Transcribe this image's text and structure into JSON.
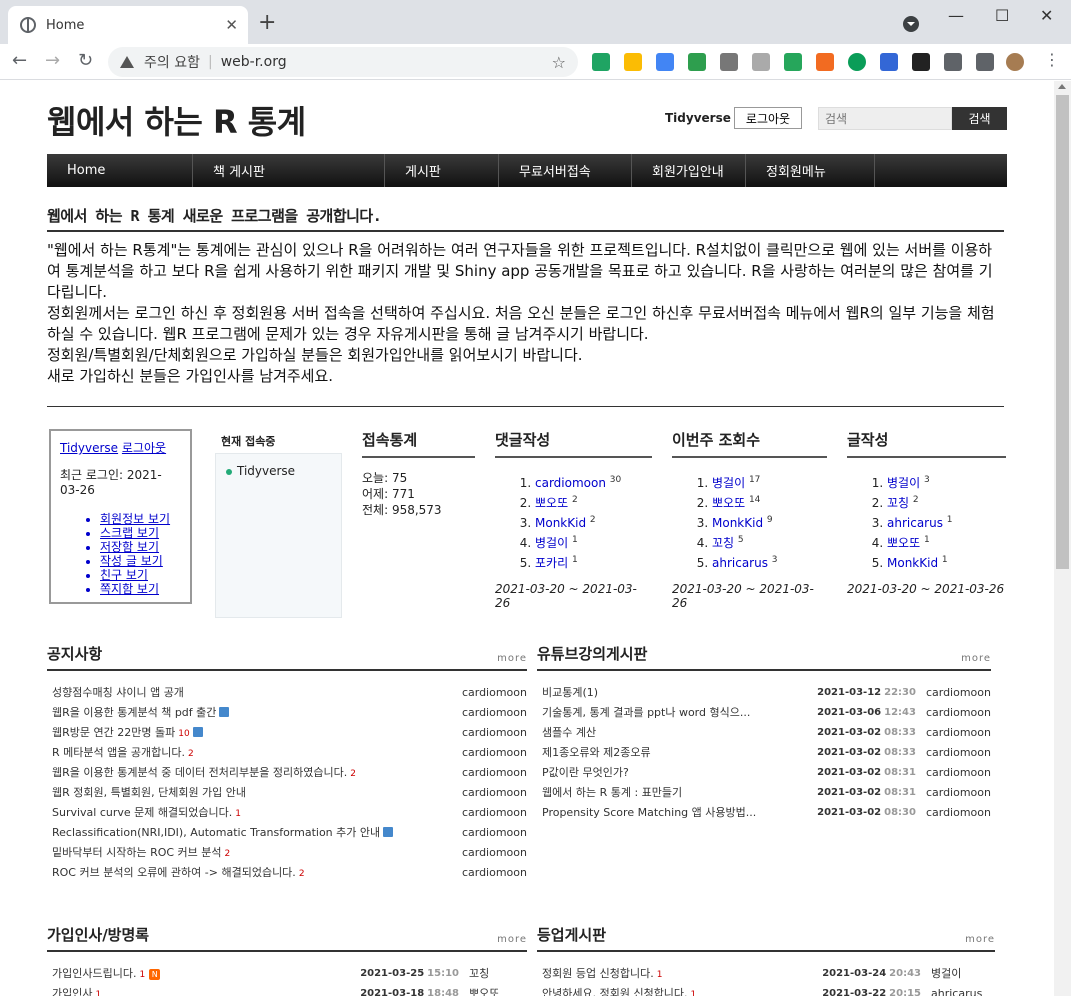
{
  "browser": {
    "tab_title": "Home",
    "security_label": "주의 요함",
    "url": "web-r.org"
  },
  "site": {
    "title": "웹에서 하는 R 통계",
    "user": "Tidyverse",
    "logout_label": "로그아웃",
    "search_placeholder": "검색",
    "search_button": "검색"
  },
  "menu": [
    "Home",
    "책 게시판",
    "게시판",
    "무료서버접속",
    "회원가입안내",
    "정회원메뉴"
  ],
  "notice": {
    "title": "웹에서 하는 R 통계 새로운 프로그램을 공개합니다.",
    "paragraphs": [
      "\"웹에서 하는 R통계\"는 통계에는 관심이 있으나 R을 어려워하는 여러 연구자들을 위한 프로젝트입니다. R설치없이 클릭만으로 웹에 있는 서버를 이용하여 통계분석을 하고 보다 R을 쉽게 사용하기 위한 패키지 개발 및 Shiny app 공동개발을 목표로 하고 있습니다.   R을 사랑하는 여러분의 많은 참여를 기다립니다.",
      "정회원께서는 로그인 하신 후 정회원용 서버 접속을 선택하여 주십시요. 처음 오신 분들은 로그인 하신후 무료서버접속 메뉴에서 웹R의 일부 기능을 체험하실 수 있습니다. 웹R 프로그램에 문제가 있는 경우 자유게시판을 통해 글 남겨주시기 바랍니다.",
      "정회원/특별회원/단체회원으로 가입하실 분들은 회원가입안내를 읽어보시기 바랍니다.",
      "새로 가입하신 분들은 가입인사를 남겨주세요."
    ]
  },
  "login_box": {
    "user_link": "Tidyverse",
    "logout_link": "로그아웃",
    "last_login": "최근 로그인: 2021-03-26",
    "links": [
      "회원정보 보기",
      "스크랩 보기",
      "저장함 보기",
      "작성 글 보기",
      "친구 보기",
      "쪽지함 보기"
    ]
  },
  "online": {
    "label": "현재 접속중",
    "users": [
      "Tidyverse"
    ]
  },
  "visit_stats": {
    "title": "접속통계",
    "today": "오늘: 75",
    "yesterday": "어제: 771",
    "total": "전체: 958,573"
  },
  "rankings": [
    {
      "title": "댓글작성",
      "items": [
        {
          "name": "cardiomoon",
          "count": "30"
        },
        {
          "name": "뽀오또",
          "count": "2"
        },
        {
          "name": "MonkKid",
          "count": "2"
        },
        {
          "name": "병걸이",
          "count": "1"
        },
        {
          "name": "포카리",
          "count": "1"
        }
      ],
      "range": "2021-03-20 ~ 2021-03-26"
    },
    {
      "title": "이번주 조회수",
      "items": [
        {
          "name": "병걸이",
          "count": "17"
        },
        {
          "name": "뽀오또",
          "count": "14"
        },
        {
          "name": "MonkKid",
          "count": "9"
        },
        {
          "name": "꼬칭",
          "count": "5"
        },
        {
          "name": "ahricarus",
          "count": "3"
        }
      ],
      "range": "2021-03-20 ~ 2021-03-26"
    },
    {
      "title": "글작성",
      "items": [
        {
          "name": "병걸이",
          "count": "3"
        },
        {
          "name": "꼬칭",
          "count": "2"
        },
        {
          "name": "ahricarus",
          "count": "1"
        },
        {
          "name": "뽀오또",
          "count": "1"
        },
        {
          "name": "MonkKid",
          "count": "1"
        }
      ],
      "range": "2021-03-20 ~ 2021-03-26"
    }
  ],
  "boards": {
    "notice": {
      "title": "공지사항",
      "more": "more",
      "rows": [
        {
          "title": "성향점수매칭 샤이니 앱 공개",
          "count": "",
          "icon": "",
          "author": "cardiomoon"
        },
        {
          "title": "웹R을 이용한 통계분석 책 pdf 출간",
          "count": "",
          "icon": "disk",
          "author": "cardiomoon"
        },
        {
          "title": "웹R방문 연간 22만명 돌파",
          "count": "10",
          "icon": "disk",
          "author": "cardiomoon"
        },
        {
          "title": "R 메타분석 앱을 공개합니다.",
          "count": "2",
          "icon": "",
          "author": "cardiomoon"
        },
        {
          "title": "웹R을 이용한 통계분석 중 데이터 전처리부분을 정리하였습니다.",
          "count": "2",
          "icon": "",
          "author": "cardiomoon"
        },
        {
          "title": "웹R 정회원, 특별회원, 단체회원 가입 안내",
          "count": "",
          "icon": "",
          "author": "cardiomoon"
        },
        {
          "title": "Survival curve 문제 해결되었습니다.",
          "count": "1",
          "icon": "",
          "author": "cardiomoon"
        },
        {
          "title": "Reclassification(NRI,IDI), Automatic Transformation 추가 안내",
          "count": "",
          "icon": "disk",
          "author": "cardiomoon"
        },
        {
          "title": "밑바닥부터 시작하는 ROC 커브 분석",
          "count": "2",
          "icon": "",
          "author": "cardiomoon"
        },
        {
          "title": "ROC 커브 분석의 오류에 관하여 -> 해결되었습니다.",
          "count": "2",
          "icon": "",
          "author": "cardiomoon"
        }
      ]
    },
    "youtube": {
      "title": "유튜브강의게시판",
      "more": "more",
      "rows": [
        {
          "title": "비교통계(1)",
          "date": "2021-03-12",
          "time": "22:30",
          "author": "cardiomoon"
        },
        {
          "title": "기술통계, 통계 결과를 ppt나 word 형식으...",
          "date": "2021-03-06",
          "time": "12:43",
          "author": "cardiomoon"
        },
        {
          "title": "샘플수 계산",
          "date": "2021-03-02",
          "time": "08:33",
          "author": "cardiomoon"
        },
        {
          "title": "제1종오류와 제2종오류",
          "date": "2021-03-02",
          "time": "08:33",
          "author": "cardiomoon"
        },
        {
          "title": "P값이란 무엇인가?",
          "date": "2021-03-02",
          "time": "08:31",
          "author": "cardiomoon"
        },
        {
          "title": "웹에서 하는 R 통계 : 표만들기",
          "date": "2021-03-02",
          "time": "08:31",
          "author": "cardiomoon"
        },
        {
          "title": "Propensity Score Matching 앱 사용방법...",
          "date": "2021-03-02",
          "time": "08:30",
          "author": "cardiomoon"
        }
      ]
    },
    "greeting": {
      "title": "가입인사/방명록",
      "more": "more",
      "rows": [
        {
          "title": "가입인사드립니다.",
          "count": "1",
          "new": "N",
          "date": "2021-03-25",
          "time": "15:10",
          "author": "꼬칭"
        },
        {
          "title": "가입인사",
          "count": "1",
          "new": "",
          "date": "2021-03-18",
          "time": "18:48",
          "author": "뽀오또"
        }
      ]
    },
    "upgrade": {
      "title": "등업게시판",
      "more": "more",
      "rows": [
        {
          "title": "정회원 등업 신청합니다.",
          "count": "1",
          "date": "2021-03-24",
          "time": "20:43",
          "author": "병걸이"
        },
        {
          "title": "안녕하세요. 정회원 신청합니다.",
          "count": "1",
          "date": "2021-03-22",
          "time": "20:15",
          "author": "ahricarus"
        }
      ]
    }
  }
}
